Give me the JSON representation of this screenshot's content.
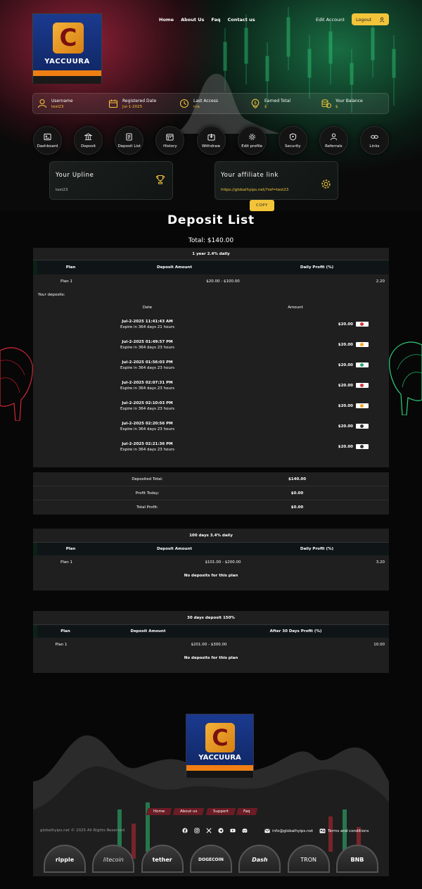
{
  "header": {
    "brand": "YACCUURA",
    "nav": [
      "Home",
      "About Us",
      "Faq",
      "Contact us"
    ],
    "edit_account": "Edit Account",
    "logout": "Logout"
  },
  "info": [
    {
      "label": "Username",
      "value": "test23",
      "icon": "user-icon"
    },
    {
      "label": "Registered Date",
      "value": "Jul-1-2025",
      "icon": "calendar-icon"
    },
    {
      "label": "Last Access",
      "value": "n/a",
      "icon": "clock-icon"
    },
    {
      "label": "Earned Total",
      "value": "$",
      "icon": "dollar-icon"
    },
    {
      "label": "Your Balance",
      "value": "$",
      "icon": "coins-icon"
    }
  ],
  "menu": [
    "Dashboard",
    "Deposit",
    "Deposit List",
    "History",
    "Withdraw",
    "Edit profile",
    "Security",
    "Referrals",
    "Links"
  ],
  "upline": {
    "title": "Your Upline",
    "value": "test23"
  },
  "affiliate": {
    "title": "Your affiliate link",
    "link": "https://globalhyips.net/?ref=test23",
    "copy": "COPY"
  },
  "page": {
    "title": "Deposit List",
    "total": "Total: $140.00"
  },
  "plans": [
    {
      "name": "1 year 2.4% daily",
      "cols": [
        "Plan",
        "Deposit Amount",
        "Daily Profit (%)"
      ],
      "row": [
        "Plan 1",
        "$20.00 - $100.00",
        "2.20"
      ]
    },
    {
      "name": "100 days 3.4% daily",
      "cols": [
        "Plan",
        "Deposit Amount",
        "Daily Profit (%)"
      ],
      "row": [
        "Plan 1",
        "$101.00 - $200.00",
        "3.20"
      ],
      "empty": "No deposits for this plan"
    },
    {
      "name": "30 days deposit 150%",
      "cols": [
        "Plan",
        "Deposit Amount",
        "After 30 Days Profit (%)"
      ],
      "row": [
        "Plan 1",
        "$201.00 - $300.00",
        "10.00"
      ],
      "empty": "No deposits for this plan"
    }
  ],
  "deposits": {
    "label": "Your deposits:",
    "col_date": "Date",
    "col_amount": "Amount",
    "rows": [
      {
        "date": "Jul-2-2025 11:41:43 AM",
        "expire": "Expire in 364 days 21 hours",
        "amount": "$20.00",
        "coin_color": "#d9303b"
      },
      {
        "date": "Jul-2-2025 01:49:57 PM",
        "expire": "Expire in 364 days 23 hours",
        "amount": "$20.00",
        "coin_color": "#f5a623"
      },
      {
        "date": "Jul-2-2025 01:56:03 PM",
        "expire": "Expire in 364 days 23 hours",
        "amount": "$20.00",
        "coin_color": "#2aa66b"
      },
      {
        "date": "Jul-2-2025 02:07:31 PM",
        "expire": "Expire in 364 days 23 hours",
        "amount": "$20.00",
        "coin_color": "#d9303b"
      },
      {
        "date": "Jul-2-2025 02:10:03 PM",
        "expire": "Expire in 364 days 23 hours",
        "amount": "$20.00",
        "coin_color": "#f5a623"
      },
      {
        "date": "Jul-2-2025 02:20:56 PM",
        "expire": "Expire in 364 days 23 hours",
        "amount": "$20.00",
        "coin_color": "#333333"
      },
      {
        "date": "Jul-2-2025 02:21:36 PM",
        "expire": "Expire in 364 days 23 hours",
        "amount": "$20.00",
        "coin_color": "#333333"
      }
    ]
  },
  "summary": [
    {
      "label": "Deposited Total:",
      "value": "$140.00"
    },
    {
      "label": "Profit Today:",
      "value": "$0.00"
    },
    {
      "label": "Total Profit:",
      "value": "$0.00"
    }
  ],
  "footer": {
    "brand": "YACCUURA",
    "nav": [
      "Home",
      "About us",
      "Support",
      "Faq"
    ],
    "copyright": "globalhyips.net © 2025 All Rights Reserved",
    "email": "info@globalhyips.net",
    "terms": "Terms and conditions",
    "coins": [
      "ripple",
      "litecoin",
      "tether",
      "DOGECOIN",
      "Dash",
      "TRON",
      "BNB"
    ]
  },
  "colors": {
    "accent": "#f3c43a",
    "panel": "#1f1f1f",
    "background": "#070707"
  }
}
